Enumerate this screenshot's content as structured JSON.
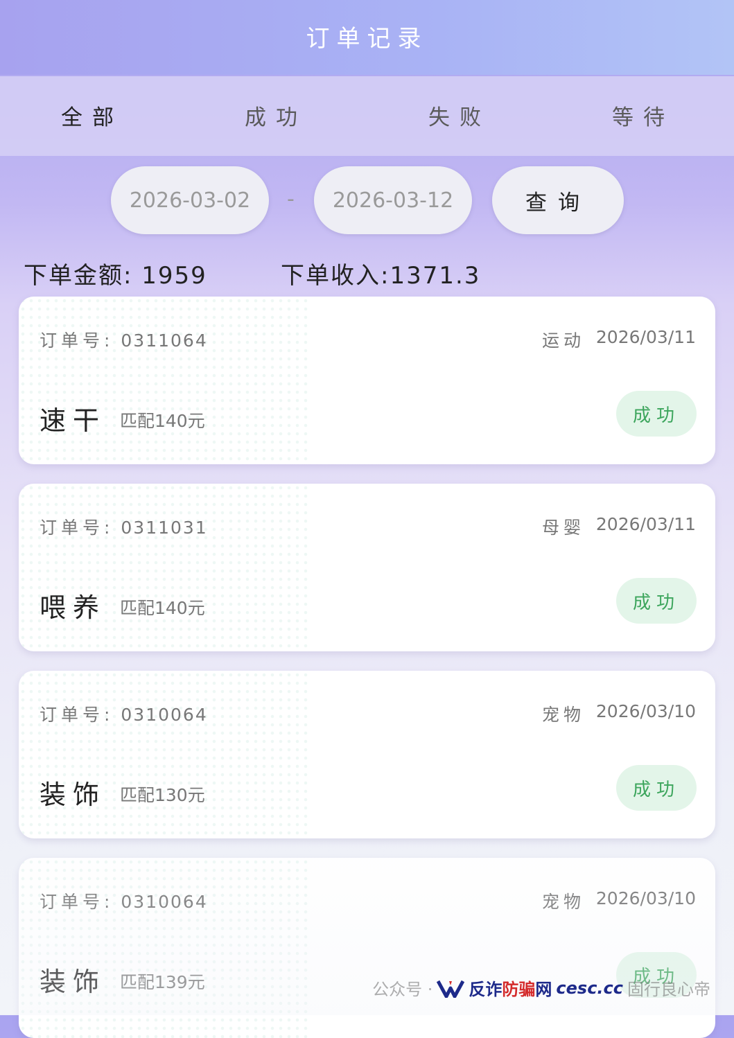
{
  "header": {
    "title": "订单记录"
  },
  "tabs": [
    {
      "label": "全部",
      "active": true
    },
    {
      "label": "成功",
      "active": false
    },
    {
      "label": "失败",
      "active": false
    },
    {
      "label": "等待",
      "active": false
    }
  ],
  "filter": {
    "start_date": "2026-03-02",
    "separator": "-",
    "end_date": "2026-03-12",
    "query_label": "查询"
  },
  "summary": {
    "amount_label": "下单金额:",
    "amount_value": "1959",
    "income_label": "下单收入:",
    "income_value": "1371.3"
  },
  "orders": [
    {
      "order_label": "订单号:",
      "order_no": "0311064",
      "category": "运动",
      "date": "2026/03/11",
      "name": "速干",
      "match": "匹配140元",
      "status": "成功"
    },
    {
      "order_label": "订单号:",
      "order_no": "0311031",
      "category": "母婴",
      "date": "2026/03/11",
      "name": "喂养",
      "match": "匹配140元",
      "status": "成功"
    },
    {
      "order_label": "订单号:",
      "order_no": "0310064",
      "category": "宠物",
      "date": "2026/03/10",
      "name": "装饰",
      "match": "匹配130元",
      "status": "成功"
    },
    {
      "order_label": "订单号:",
      "order_no": "0310064",
      "category": "宠物",
      "date": "2026/03/10",
      "name": "装饰",
      "match": "匹配139元",
      "status": "成功"
    }
  ],
  "watermark": {
    "part1": "公众号 ·",
    "brand_cn_1": "反诈",
    "brand_cn_2": "防骗",
    "brand_cn_3": "网",
    "brand_domain": "cesc.cc",
    "part2": "固行良心帝"
  },
  "colors": {
    "header_bg": "#a7a2ef",
    "status_success_bg": "#e3f5e9",
    "status_success_text": "#3ca55c"
  }
}
